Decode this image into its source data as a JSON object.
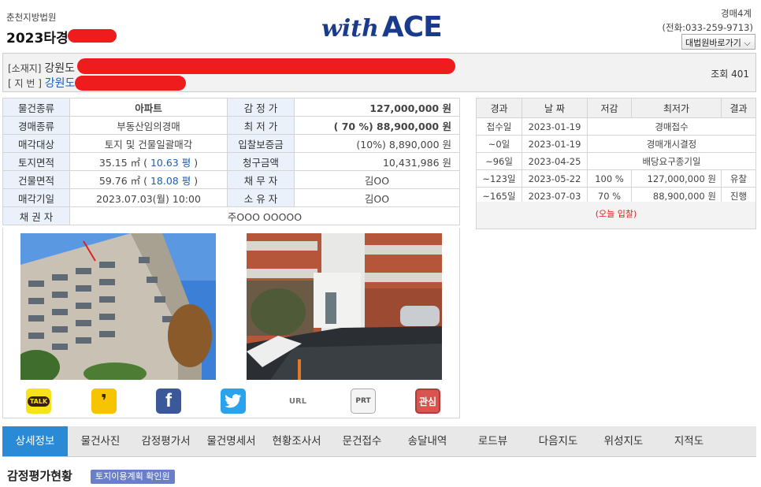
{
  "header": {
    "court": "춘천지방법원",
    "case_no": "2023타경",
    "logo_with": "with",
    "logo_ace": "ACE",
    "dept": "경매4계",
    "phone": "(전화:033-259-9713)",
    "shortcut_label": "대법원바로가기 ⌵"
  },
  "address": {
    "location_label": "[소재지]",
    "location_value": "강원도",
    "lot_label": "[ 지 번 ]",
    "lot_value": "강원도",
    "views": "조회 401"
  },
  "info": {
    "rows": [
      {
        "l1": "물건종류",
        "v1": "아파트",
        "l2": "감 정 가",
        "v2": "127,000,000 원"
      },
      {
        "l1": "경매종류",
        "v1": "부동산임의경매",
        "l2": "최 저 가",
        "v2": "( 70 %) 88,900,000 원"
      },
      {
        "l1": "매각대상",
        "v1": "토지 및 건물일괄매각",
        "l2": "입찰보증금",
        "v2": "(10%) 8,890,000 원"
      },
      {
        "l1": "토지면적",
        "v1a": "35.15 ㎡ ( ",
        "v1b": "10.63 평",
        "v1c": ")",
        "l2": "청구금액",
        "v2": "10,431,986 원"
      },
      {
        "l1": "건물면적",
        "v1a": "59.76 ㎡ ( ",
        "v1b": "18.08 평",
        "v1c": ")",
        "l2": "채 무 자",
        "v2": "김OO"
      },
      {
        "l1": "매각기일",
        "v1": "2023.07.03(월) 10:00",
        "l2": "소 유 자",
        "v2": "김OO"
      }
    ],
    "creditor_label": "채 권 자",
    "creditor_value": "주OOO OOOOO"
  },
  "share": {
    "talk": "TALK",
    "story": "❜",
    "facebook": "f",
    "twitter": "🐦",
    "url": "URL",
    "print": "PRT",
    "favorite": "관심"
  },
  "history": {
    "headers": [
      "경과",
      "날 짜",
      "저감",
      "최저가",
      "결과"
    ],
    "rows": [
      {
        "elapsed": "접수일",
        "date": "2023-01-19",
        "merged": "경매접수"
      },
      {
        "elapsed": "~0일",
        "date": "2023-01-19",
        "merged": "경매개시결정"
      },
      {
        "elapsed": "~96일",
        "date": "2023-04-25",
        "merged": "배당요구종기일"
      },
      {
        "elapsed": "~123일",
        "date": "2023-05-22",
        "cut": "100 %",
        "price": "127,000,000 원",
        "result": "유찰"
      },
      {
        "elapsed": "~165일",
        "date": "2023-07-03",
        "cut": "70 %",
        "price": "88,900,000 원",
        "result": "진행"
      }
    ],
    "today": "(오늘 입찰)"
  },
  "tabs": [
    "상세정보",
    "물건사진",
    "감정평가서",
    "물건명세서",
    "현황조사서",
    "문건접수",
    "송달내역",
    "로드뷰",
    "다음지도",
    "위성지도",
    "지적도"
  ],
  "section": {
    "title": "감정평가현황",
    "confirm_button": "토지이용계획 확인원"
  },
  "colors": {
    "accent_blue": "#2a8ad6",
    "label_bg": "#eaf1fb",
    "redaction": "#ee1c1c",
    "logo": "#1a3a8c"
  }
}
